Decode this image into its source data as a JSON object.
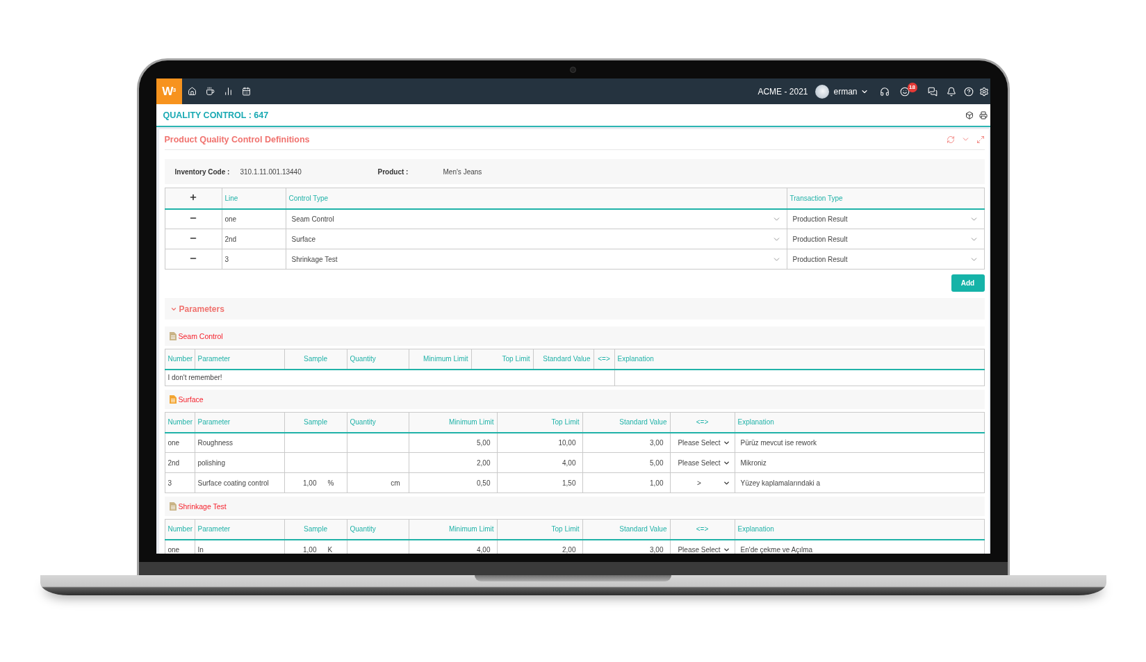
{
  "topbar": {
    "logo": "W$^{3}$",
    "company": "ACME - 2021",
    "user": "erman",
    "notification_count": "18"
  },
  "page_title": "QUALITY CONTROL : 647",
  "panel": {
    "title": "Product Quality Control Definitions"
  },
  "info": [
    {
      "label": "Inventory Code :",
      "value": "310.1.11.001.13440"
    },
    {
      "label": "Product :",
      "value": "Men's Jeans"
    }
  ],
  "lines_table": {
    "columns": [
      "Line",
      "Control Type",
      "Transaction Type"
    ],
    "rows": [
      {
        "line": "one",
        "control_type": "Seam Control",
        "transaction_type": "Production Result"
      },
      {
        "line": "2nd",
        "control_type": "Surface",
        "transaction_type": "Production Result"
      },
      {
        "line": "3",
        "control_type": "Shrinkage Test",
        "transaction_type": "Production Result"
      }
    ]
  },
  "add_button": "Add",
  "parameters": {
    "title": "Parameters",
    "expanded": true,
    "groups": [
      {
        "title": "Seam Control",
        "color": "#c9b487",
        "columns": [
          "Number",
          "Parameter",
          "Sample",
          "Quantity",
          "Minimum Limit",
          "Top Limit",
          "Standard Value",
          "<=>",
          "Explanation"
        ],
        "note": "I don't remember!"
      },
      {
        "title": "Surface",
        "color": "#f2a532",
        "columns": [
          "Number",
          "Parameter",
          "Sample",
          "Quantity",
          "Minimum Limit",
          "Top Limit",
          "Standard Value",
          "<=>",
          "Explanation"
        ],
        "rows": [
          {
            "number": "one",
            "parameter": "Roughness",
            "minimum_limit": "5,00",
            "top_limit": "10,00",
            "standard_value": "3,00",
            "comparison": "Please Select",
            "explanation": "Pürüz mevcut ise rework"
          },
          {
            "number": "2nd",
            "parameter": "polishing",
            "minimum_limit": "2,00",
            "top_limit": "4,00",
            "standard_value": "5,00",
            "comparison": "Please Select",
            "explanation": "Mikroniz"
          },
          {
            "number": "3",
            "parameter": "Surface coating control",
            "sample": "1,00",
            "sample_unit": "%",
            "quantity": "cm",
            "minimum_limit": "0,50",
            "top_limit": "1,50",
            "standard_value": "1,00",
            "comparison": ">",
            "explanation": "Yüzey kaplamalarındaki a"
          }
        ]
      },
      {
        "title": "Shrinkage Test",
        "color": "#c9b487",
        "columns": [
          "Number",
          "Parameter",
          "Sample",
          "Quantity",
          "Minimum Limit",
          "Top Limit",
          "Standard Value",
          "<=>",
          "Explanation"
        ],
        "rows": [
          {
            "number": "one",
            "parameter": "In",
            "sample": "1,00",
            "sample_unit": "K",
            "minimum_limit": "4,00",
            "top_limit": "2,00",
            "standard_value": "3,00",
            "comparison": "Please Select",
            "explanation": "En'de çekme ve Açılma"
          }
        ]
      }
    ]
  }
}
